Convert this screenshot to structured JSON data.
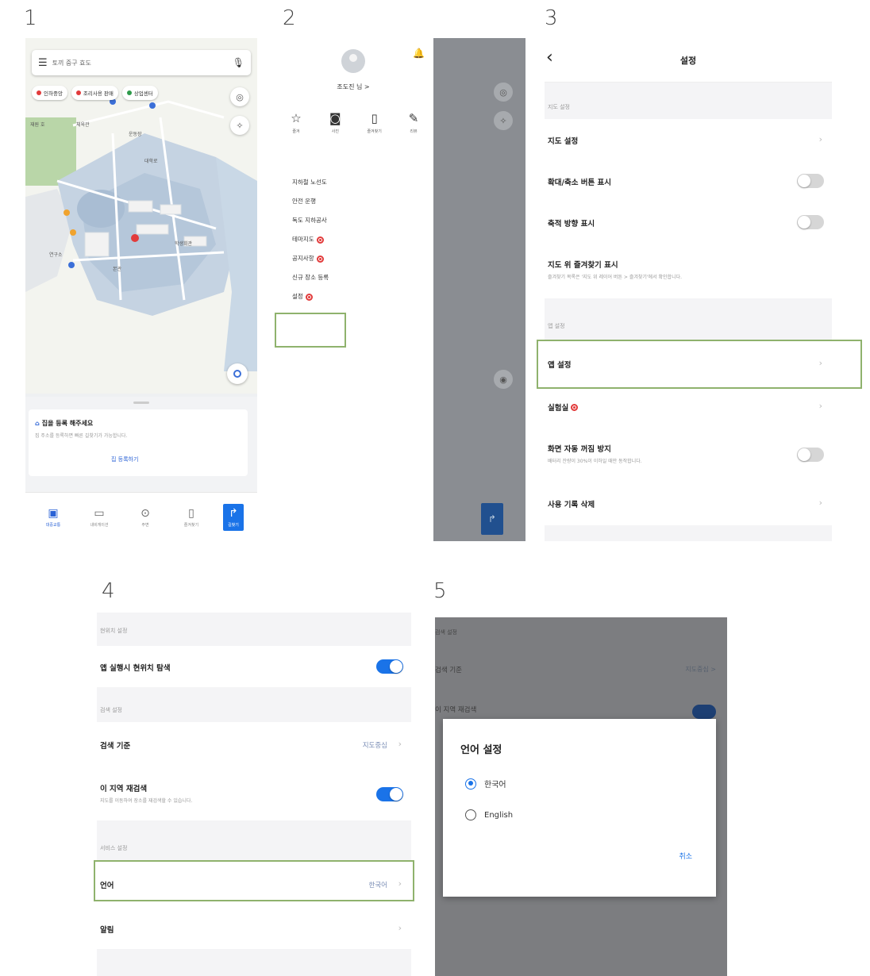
{
  "steps": [
    "1",
    "2",
    "3",
    "4",
    "5"
  ],
  "colors": {
    "accent": "#1a73e8",
    "highlight": "#8fb26d",
    "badge": "#e23b3b"
  },
  "panel1": {
    "search_placeholder": "토끼 중구 효도",
    "chips": [
      {
        "label": "인하중앙",
        "color": "#e23b3b"
      },
      {
        "label": "조리사용 판매",
        "color": "#e23b3b"
      },
      {
        "label": "상업센터",
        "color": "#2e9a4a"
      }
    ],
    "map_labels": [
      "재원 호",
      "체육관",
      "운동장",
      "대학로",
      "본관",
      "학생회관",
      "연구소"
    ],
    "card": {
      "title": "집을 등록 해주세요",
      "subtitle": "집 주소를 등록하면 빠른 길찾기가 가능합니다.",
      "button": "집 등록하기"
    },
    "tabs": [
      {
        "label": "대중교통",
        "icon": "bus-icon"
      },
      {
        "label": "내비게이션",
        "icon": "car-icon"
      },
      {
        "label": "주변",
        "icon": "pin-icon"
      },
      {
        "label": "즐겨찾기",
        "icon": "bookmark-icon"
      },
      {
        "label": "길찾기",
        "icon": "route-icon"
      }
    ]
  },
  "panel2": {
    "username": "조도진 님 >",
    "quick": [
      {
        "label": "즐겨",
        "icon": "star-icon"
      },
      {
        "label": "사진",
        "icon": "camera-icon"
      },
      {
        "label": "즐겨찾기",
        "icon": "bookmark-icon"
      },
      {
        "label": "리뷰",
        "icon": "pencil-icon"
      }
    ],
    "menu": [
      {
        "label": "지하철 노선도",
        "badge": false
      },
      {
        "label": "안전 운행",
        "badge": false
      },
      {
        "label": "독도 지하공사",
        "badge": false
      },
      {
        "label": "테마지도",
        "badge": true
      },
      {
        "label": "공지사항",
        "badge": true
      },
      {
        "label": "신규 장소 등록",
        "badge": false
      },
      {
        "label": "설정",
        "badge": true
      }
    ]
  },
  "panel3": {
    "title": "설정",
    "sections": [
      {
        "header": "지도 설정"
      },
      {
        "header": "앱 설정"
      }
    ],
    "rows": [
      {
        "label": "지도 설정",
        "type": "chevron"
      },
      {
        "label": "확대/축소 버튼 표시",
        "type": "toggle",
        "on": false
      },
      {
        "label": "축적 방향 표시",
        "type": "toggle",
        "on": false
      },
      {
        "label": "지도 위 즐겨찾기 표시",
        "sub": "즐겨찾기 목록은 '지도 위 레이어 버튼 > 즐겨찾기'에서 확인합니다.",
        "type": "none"
      },
      {
        "label": "앱 설정",
        "type": "chevron"
      },
      {
        "label": "실험실",
        "type": "chevron",
        "badge": true
      },
      {
        "label": "화면 자동 꺼짐 방지",
        "sub": "배터리 잔량이 30%이 이하일 때만 동작합니다.",
        "type": "toggle",
        "on": false
      },
      {
        "label": "사용 기록 삭제",
        "type": "chevron"
      }
    ]
  },
  "panel4": {
    "rows": [
      {
        "section": "현위치 설정"
      },
      {
        "label": "앱 실행시 현위치 탐색",
        "type": "toggle",
        "on": true
      },
      {
        "section": "검색 설정"
      },
      {
        "label": "검색 기준",
        "value": "지도중심",
        "type": "chevron"
      },
      {
        "label": "이 지역 재검색",
        "sub": "지도를 이동하여 장소를 재검색할 수 있습니다.",
        "type": "toggle",
        "on": true
      },
      {
        "section": "서비스 설정"
      },
      {
        "label": "언어",
        "value": "한국어",
        "type": "chevron"
      },
      {
        "label": "알림",
        "type": "chevron"
      }
    ]
  },
  "panel5": {
    "bg_rows": [
      "검색 설정",
      "검색 기준",
      "이 지역 재검색"
    ],
    "bg_value": "지도중심 >",
    "dialog": {
      "title": "언어 설정",
      "options": [
        "한국어",
        "English"
      ],
      "selected": 0,
      "cancel": "취소"
    }
  }
}
